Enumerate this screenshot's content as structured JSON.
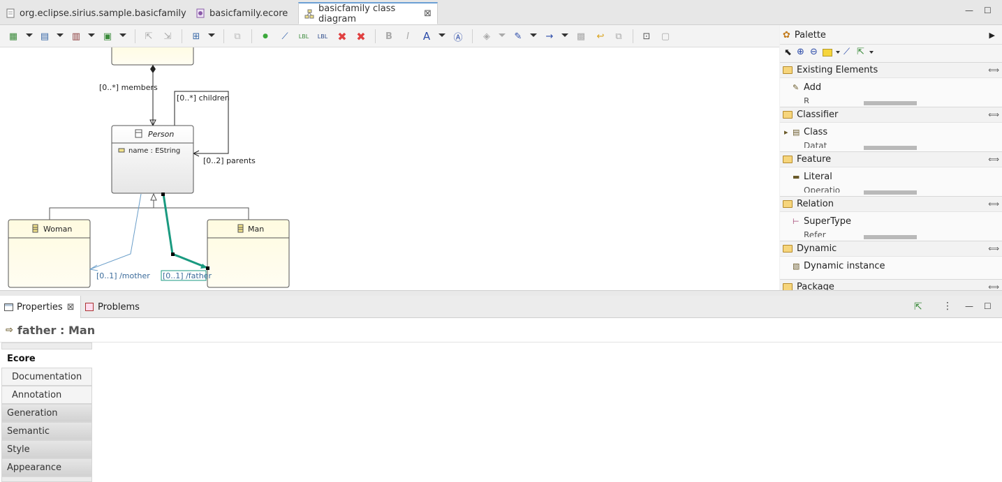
{
  "editor_tabs": [
    {
      "label": "org.eclipse.sirius.sample.basicfamily"
    },
    {
      "label": "basicfamily.ecore"
    },
    {
      "label": "basicfamily class diagram",
      "active": true
    }
  ],
  "diagram": {
    "classes": [
      {
        "name": "Person",
        "attribute": "name : EString"
      },
      {
        "name": "Woman"
      },
      {
        "name": "Man"
      }
    ],
    "labels": {
      "members": "[0..*] members",
      "children": "[0..*] children",
      "parents": "[0..2] parents",
      "mother": "[0..1] /mother",
      "father": "[0..1] /father"
    },
    "colors": {
      "class_fill": "#fffde8",
      "selected_edge": "#1a9a80",
      "derived_edge": "#6a9ec9"
    }
  },
  "palette": {
    "title": "Palette",
    "drawers": [
      {
        "title": "Existing Elements",
        "item": "Add",
        "partial": "R"
      },
      {
        "title": "Classifier",
        "item": "Class",
        "partial": "Datat"
      },
      {
        "title": "Feature",
        "item": "Literal",
        "partial": "Operatio"
      },
      {
        "title": "Relation",
        "item": "SuperType",
        "partial": "Refer"
      },
      {
        "title": "Dynamic",
        "item": "Dynamic instance",
        "partial": ""
      },
      {
        "title": "Package",
        "item": "",
        "partial": ""
      }
    ]
  },
  "views": {
    "tabs": [
      {
        "label": "Properties"
      },
      {
        "label": "Problems"
      }
    ],
    "properties_title": "father : Man",
    "property_tabs": [
      "Ecore",
      "Documentation",
      "Annotation",
      "Generation",
      "Semantic",
      "Style",
      "Appearance"
    ]
  }
}
